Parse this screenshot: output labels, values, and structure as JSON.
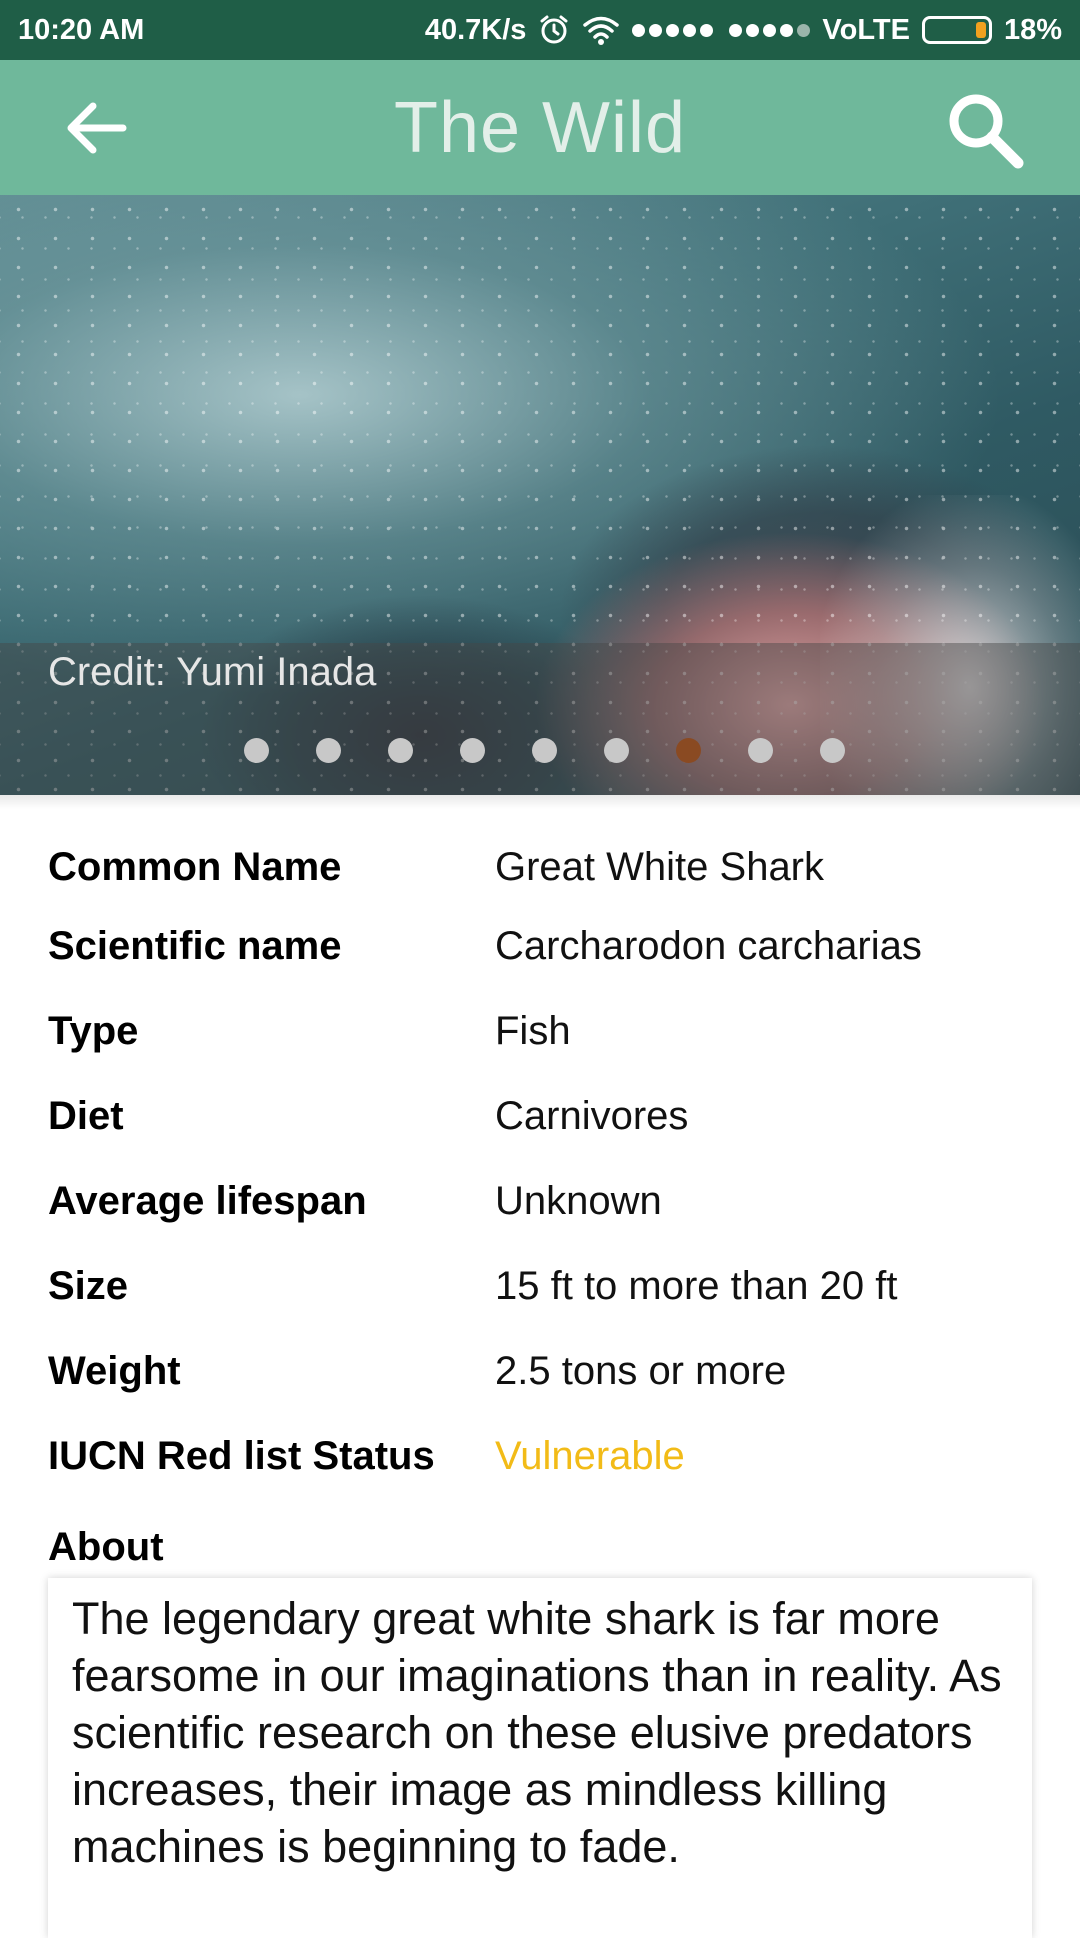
{
  "status_bar": {
    "time": "10:20 AM",
    "net_speed": "40.7K/s",
    "network_type": "VoLTE",
    "battery": "18%",
    "battery_level": 0.18,
    "icons": [
      "alarm-icon",
      "wifi-icon",
      "signal-icon",
      "battery-icon"
    ]
  },
  "app_bar": {
    "title": "The Wild",
    "back_icon": "arrow-left-icon",
    "search_icon": "search-icon"
  },
  "hero": {
    "credit": "Credit: Yumi Inada",
    "pager": {
      "count": 9,
      "active_index": 6
    }
  },
  "details": {
    "rows": [
      {
        "label": "Common Name",
        "value": "Great White Shark"
      },
      {
        "label": "Scientific name",
        "value": "Carcharodon carcharias"
      },
      {
        "label": "Type",
        "value": "Fish"
      },
      {
        "label": "Diet",
        "value": "Carnivores"
      },
      {
        "label": "Average lifespan",
        "value": "Unknown"
      },
      {
        "label": "Size",
        "value": "15 ft to more than 20 ft"
      },
      {
        "label": "Weight",
        "value": "2.5 tons or more"
      },
      {
        "label": "IUCN Red list Status",
        "value": "Vulnerable"
      }
    ],
    "status_color": "#f2bb17"
  },
  "about": {
    "label": "About",
    "text": "The legendary great white shark is far more fearsome in our imaginations than in reality. As scientific research on these elusive predators increases, their image as mindless killing machines is beginning to fade."
  },
  "colors": {
    "status_bar_bg": "#1f5e47",
    "app_bar_bg": "#6fb89b",
    "pager_active": "#8a4a22"
  }
}
